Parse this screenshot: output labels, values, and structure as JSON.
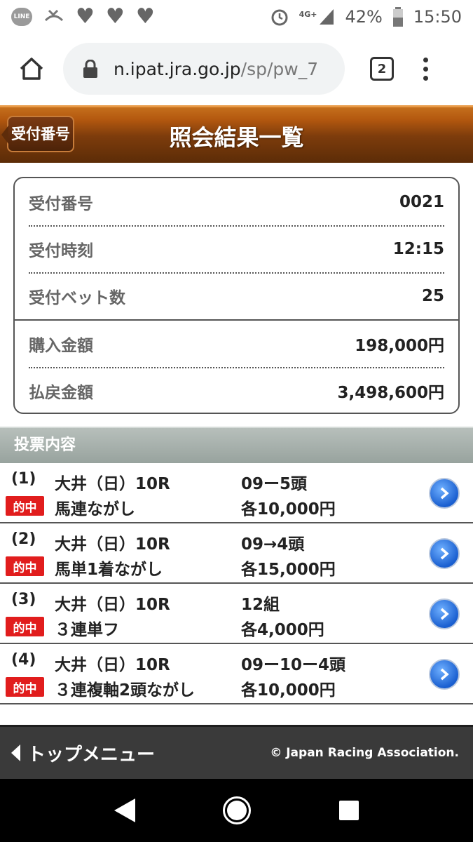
{
  "status_bar": {
    "line_label": "LINE",
    "network": "4G+",
    "battery": "42%",
    "time": "15:50"
  },
  "browser": {
    "url_host": "n.ipat.jra.go.jp",
    "url_path": "/sp/pw_7",
    "tab_count": "2"
  },
  "header": {
    "back_label": "受付番号",
    "title": "照会結果一覧"
  },
  "info": {
    "rows": [
      {
        "label": "受付番号",
        "value": "0021"
      },
      {
        "label": "受付時刻",
        "value": "12:15"
      },
      {
        "label": "受付ベット数",
        "value": "25"
      },
      {
        "label": "購入金額",
        "value": "198,000円"
      },
      {
        "label": "払戻金額",
        "value": "3,498,600円"
      }
    ]
  },
  "section": {
    "title": "投票内容"
  },
  "bets": [
    {
      "num": "(1)",
      "badge": "的中",
      "race": "大井（日）10R",
      "type": "馬連ながし",
      "combo": "09ー5頭",
      "amount": "各10,000円"
    },
    {
      "num": "(2)",
      "badge": "的中",
      "race": "大井（日）10R",
      "type": "馬単1着ながし",
      "combo": "09→4頭",
      "amount": "各15,000円"
    },
    {
      "num": "(3)",
      "badge": "的中",
      "race": "大井（日）10R",
      "type": "３連単フ",
      "combo": "12組",
      "amount": "各4,000円"
    },
    {
      "num": "(4)",
      "badge": "的中",
      "race": "大井（日）10R",
      "type": "３連複軸2頭ながし",
      "combo": "09ー10ー4頭",
      "amount": "各10,000円"
    }
  ],
  "footer": {
    "top_menu": "トップメニュー",
    "copyright": "© Japan Racing Association."
  }
}
